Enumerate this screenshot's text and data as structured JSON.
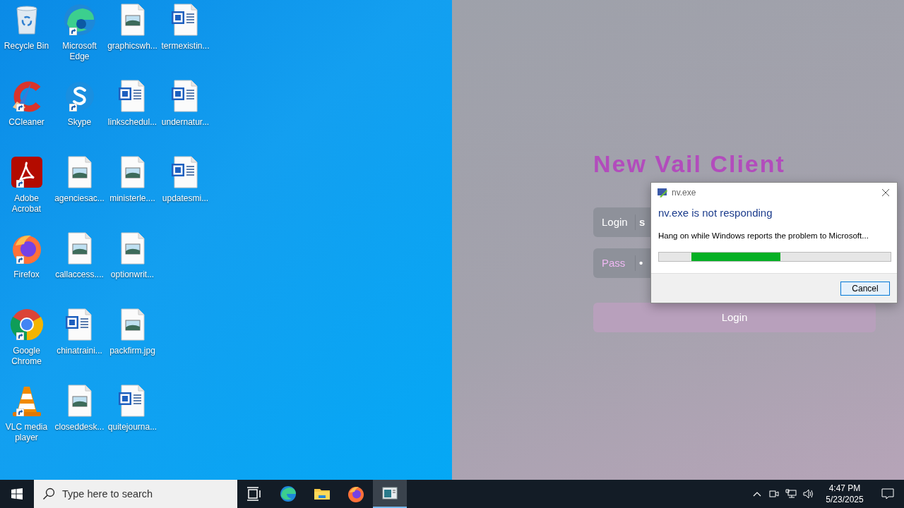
{
  "desktop": {
    "icons": [
      {
        "label": "Recycle Bin",
        "kind": "recycle",
        "shortcut": false
      },
      {
        "label": "CCleaner",
        "kind": "ccleaner",
        "shortcut": true
      },
      {
        "label": "Adobe Acrobat",
        "kind": "acrobat",
        "shortcut": true
      },
      {
        "label": "Firefox",
        "kind": "firefox",
        "shortcut": true
      },
      {
        "label": "Google Chrome",
        "kind": "chrome",
        "shortcut": true
      },
      {
        "label": "VLC media player",
        "kind": "vlc",
        "shortcut": true
      },
      {
        "label": "Microsoft Edge",
        "kind": "edge",
        "shortcut": true
      },
      {
        "label": "Skype",
        "kind": "skype",
        "shortcut": true
      },
      {
        "label": "agenciesac...",
        "kind": "image",
        "shortcut": false
      },
      {
        "label": "callaccess....",
        "kind": "image",
        "shortcut": false
      },
      {
        "label": "chinatraini...",
        "kind": "word",
        "shortcut": false
      },
      {
        "label": "closeddesk...",
        "kind": "image",
        "shortcut": false
      },
      {
        "label": "graphicswh...",
        "kind": "image",
        "shortcut": false
      },
      {
        "label": "linkschedul...",
        "kind": "word",
        "shortcut": false
      },
      {
        "label": "ministerle....",
        "kind": "image",
        "shortcut": false
      },
      {
        "label": "optionwrit...",
        "kind": "image",
        "shortcut": false
      },
      {
        "label": "packfirm.jpg",
        "kind": "image",
        "shortcut": false
      },
      {
        "label": "quitejourna...",
        "kind": "word",
        "shortcut": false
      },
      {
        "label": "termexistin...",
        "kind": "word",
        "shortcut": false
      },
      {
        "label": "undernatur...",
        "kind": "word",
        "shortcut": false
      },
      {
        "label": "updatesmi...",
        "kind": "word",
        "shortcut": false
      }
    ]
  },
  "app_window": {
    "title": "New Vail Client",
    "fields": [
      {
        "label": "Login",
        "value": "s",
        "focused": false
      },
      {
        "label": "Pass",
        "value": "•",
        "focused": true
      }
    ],
    "button": "Login"
  },
  "dialog": {
    "title": "nv.exe",
    "heading": "nv.exe is not responding",
    "message": "Hang on while Windows reports the problem to Microsoft...",
    "progress": {
      "level": 0.385
    },
    "buttons": [
      "Cancel"
    ]
  },
  "taskbar": {
    "search": {
      "placeholder": "Type here to search"
    },
    "apps": [
      {
        "kind": "taskview",
        "active": false
      },
      {
        "kind": "edge",
        "active": false
      },
      {
        "kind": "explorer",
        "active": false
      },
      {
        "kind": "firefox",
        "active": false
      },
      {
        "kind": "window",
        "active": true
      }
    ],
    "time": "4:47 PM",
    "date": "5/23/2025"
  }
}
